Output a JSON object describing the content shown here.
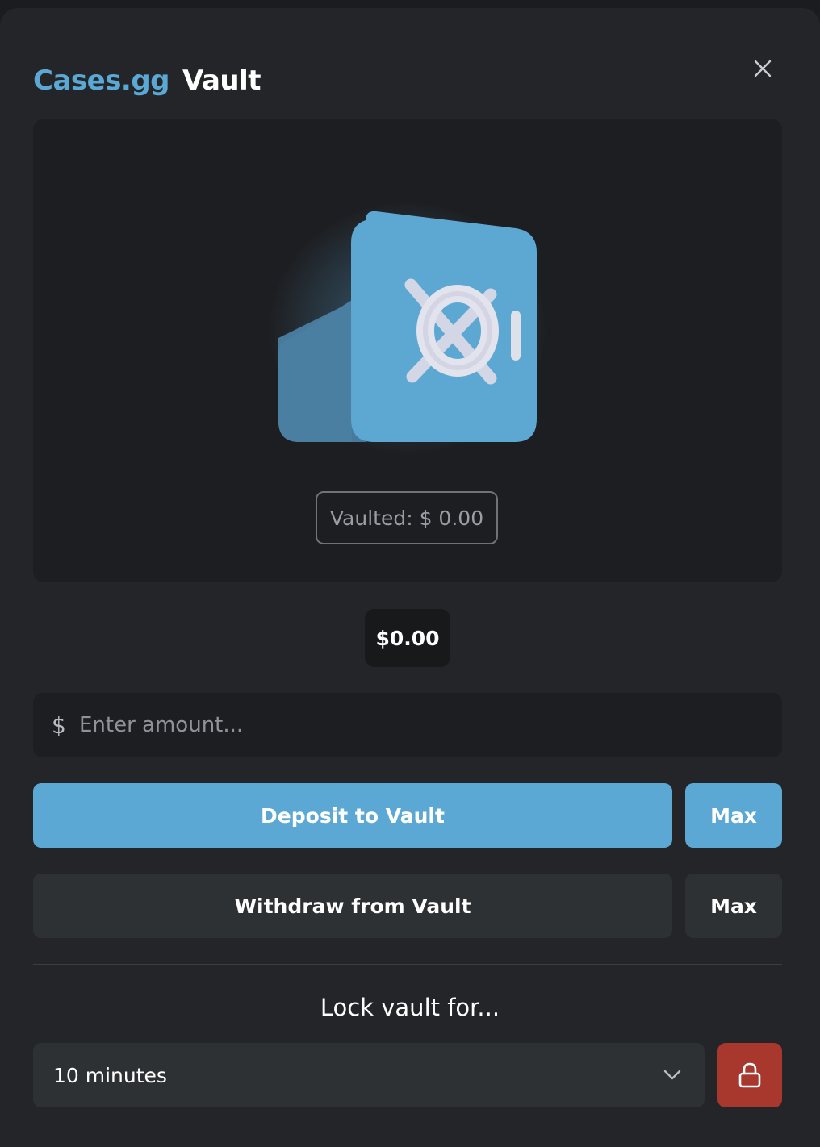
{
  "header": {
    "brand": "Cases.gg",
    "title": "Vault",
    "close_icon": "close-icon"
  },
  "vault": {
    "illustration_icon": "safe-icon",
    "vaulted_label": "Vaulted: $ 0.00"
  },
  "balance": {
    "value": "$0.00"
  },
  "amount_input": {
    "currency_symbol": "$",
    "placeholder": "Enter amount...",
    "value": ""
  },
  "actions": {
    "deposit_label": "Deposit to Vault",
    "deposit_max_label": "Max",
    "withdraw_label": "Withdraw from Vault",
    "withdraw_max_label": "Max"
  },
  "lock": {
    "label": "Lock vault for...",
    "selected_duration": "10 minutes",
    "chevron_icon": "chevron-down-icon",
    "lock_icon": "lock-icon"
  },
  "colors": {
    "accent": "#5ba8d4",
    "danger": "#a8372e",
    "background": "#232528"
  }
}
